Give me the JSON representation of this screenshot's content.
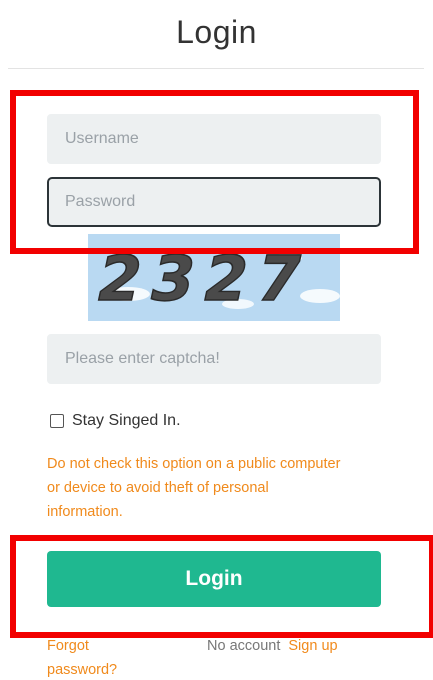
{
  "page": {
    "title": "Login"
  },
  "form": {
    "username_placeholder": "Username",
    "password_placeholder": "Password",
    "captcha_placeholder": "Please enter captcha!",
    "captcha_text": "2327",
    "remember_label": "Stay Singed In.",
    "warning_text": "Do not check this option on a public computer or device to avoid theft of personal information.",
    "login_button": "Login",
    "forgot_link": "Forgot password?",
    "no_account_text": "No account",
    "signup_link": "Sign up"
  },
  "colors": {
    "accent": "#1fb890",
    "warning": "#f08a1c",
    "highlight": "#f20000",
    "field_bg": "#edf0f1"
  }
}
